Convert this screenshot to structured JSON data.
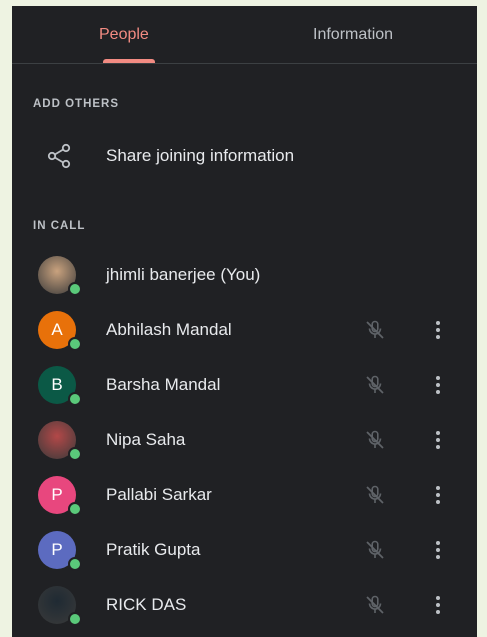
{
  "tabs": [
    {
      "label": "People",
      "active": true
    },
    {
      "label": "Information",
      "active": false
    }
  ],
  "add_others": {
    "label": "ADD OTHERS",
    "share_label": "Share joining information",
    "icon": "share-icon"
  },
  "in_call": {
    "label": "IN CALL",
    "participants": [
      {
        "name": "jhimli banerjee (You)",
        "initial": "",
        "avatar": "photo",
        "avatar_color": "#c9a27e",
        "muted_icon": false
      },
      {
        "name": "Abhilash Mandal",
        "initial": "A",
        "avatar": "letter",
        "avatar_color": "#e8710a",
        "muted_icon": true
      },
      {
        "name": "Barsha Mandal",
        "initial": "B",
        "avatar": "letter",
        "avatar_color": "#0b5946",
        "muted_icon": true
      },
      {
        "name": "Nipa Saha",
        "initial": "",
        "avatar": "photo",
        "avatar_color": "#b34848",
        "muted_icon": true
      },
      {
        "name": "Pallabi Sarkar",
        "initial": "P",
        "avatar": "letter",
        "avatar_color": "#e8477e",
        "muted_icon": true
      },
      {
        "name": "Pratik Gupta",
        "initial": "P",
        "avatar": "letter",
        "avatar_color": "#5c6bc0",
        "muted_icon": true
      },
      {
        "name": "RICK DAS",
        "initial": "",
        "avatar": "photo",
        "avatar_color": "#1f2a33",
        "muted_icon": true
      }
    ]
  },
  "colors": {
    "panel_bg": "#202124",
    "accent": "#f28b82",
    "online": "#5ac97a",
    "text": "#e8eaed",
    "muted_text": "#bdc1c6"
  }
}
